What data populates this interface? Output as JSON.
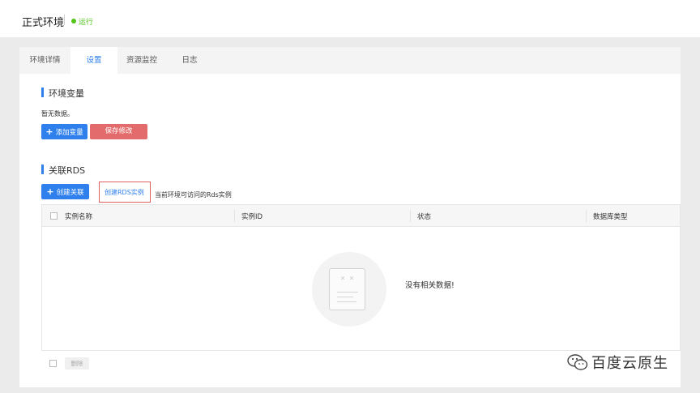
{
  "header": {
    "title": "正式环境",
    "status": "运行",
    "status_color": "#52c41a"
  },
  "tabs": [
    {
      "label": "环境详情",
      "active": false
    },
    {
      "label": "设置",
      "active": true
    },
    {
      "label": "资源监控",
      "active": false
    },
    {
      "label": "日志",
      "active": false
    }
  ],
  "env_vars": {
    "title": "环境变量",
    "empty_text": "暂无数据。",
    "add_button": "添加变量",
    "save_button": "保存修改"
  },
  "rds": {
    "title": "关联RDS",
    "create_link_button": "创建关联",
    "create_rds_link": "创建RDS实例",
    "hint": "当前环境可访问的Rds实例",
    "columns": [
      "实例名称",
      "实例ID",
      "状态",
      "数据库类型"
    ],
    "empty_message": "没有相关数据!",
    "delete_button": "删除"
  },
  "watermark": {
    "text": "百度云原生",
    "icon": "wechat-icon"
  },
  "colors": {
    "accent": "#2f80ed",
    "danger": "#e46b6b",
    "highlight_border": "#e06060"
  }
}
